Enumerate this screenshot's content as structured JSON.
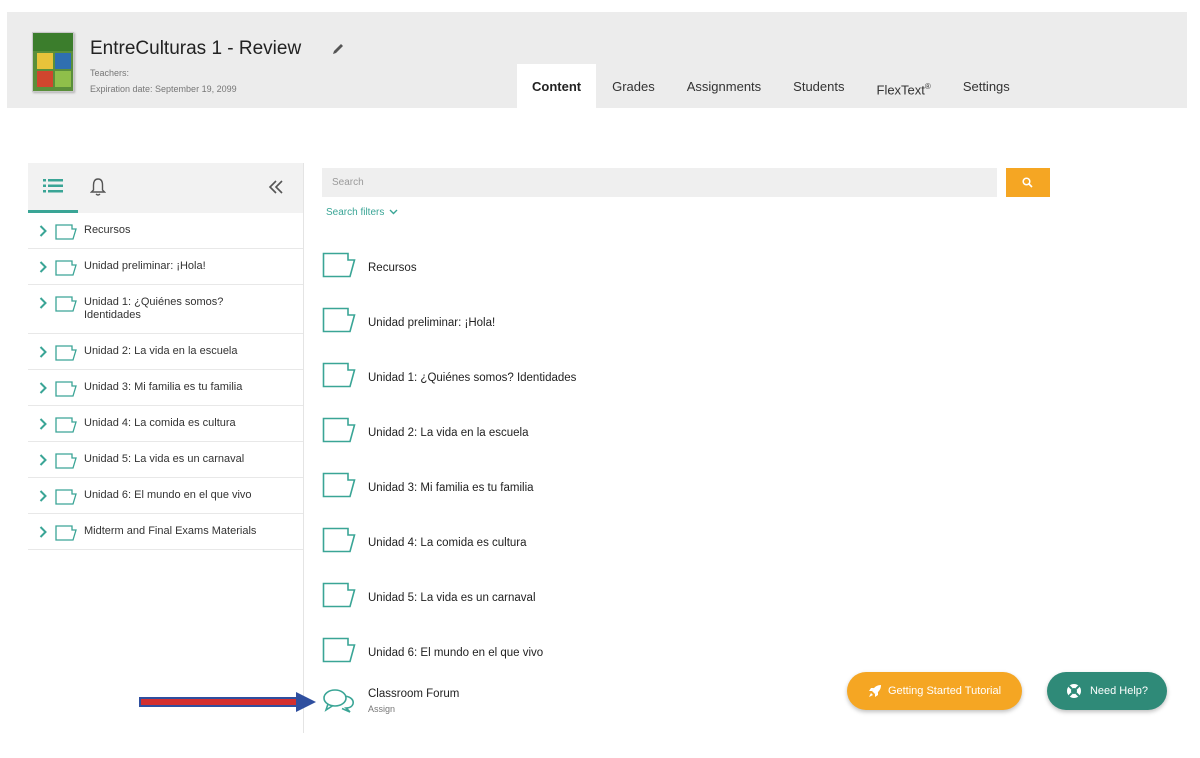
{
  "course": {
    "title": "EntreCulturas 1 - Review",
    "teachers": "Teachers:",
    "expiration": "Expiration date: September 19, 2099"
  },
  "tabs": [
    {
      "label": "Content",
      "active": true
    },
    {
      "label": "Grades",
      "active": false
    },
    {
      "label": "Assignments",
      "active": false
    },
    {
      "label": "Students",
      "active": false
    },
    {
      "label": "FlexText",
      "sup": "®",
      "active": false
    },
    {
      "label": "Settings",
      "active": false
    }
  ],
  "sidebar": {
    "items": [
      {
        "label": "Recursos"
      },
      {
        "label": "Unidad preliminar: ¡Hola!"
      },
      {
        "label": "Unidad 1: ¿Quiénes somos? Identidades"
      },
      {
        "label": "Unidad 2: La vida en la escuela"
      },
      {
        "label": "Unidad 3: Mi familia es tu familia"
      },
      {
        "label": "Unidad 4: La comida es cultura"
      },
      {
        "label": "Unidad 5: La vida es un carnaval"
      },
      {
        "label": "Unidad 6: El mundo en el que vivo"
      },
      {
        "label": "Midterm and Final Exams Materials"
      }
    ]
  },
  "search": {
    "placeholder": "Search",
    "filters_label": "Search filters"
  },
  "content": {
    "items": [
      {
        "label": "Recursos"
      },
      {
        "label": "Unidad preliminar: ¡Hola!"
      },
      {
        "label": "Unidad 1: ¿Quiénes somos? Identidades"
      },
      {
        "label": "Unidad 2: La vida en la escuela"
      },
      {
        "label": "Unidad 3: Mi familia es tu familia"
      },
      {
        "label": "Unidad 4: La comida es cultura"
      },
      {
        "label": "Unidad 5: La vida es un carnaval"
      },
      {
        "label": "Unidad 6: El mundo en el que vivo"
      }
    ],
    "forum": {
      "label": "Classroom Forum",
      "sub": "Assign"
    }
  },
  "buttons": {
    "tutorial": "Getting Started Tutorial",
    "help": "Need Help?"
  },
  "colors": {
    "accent": "#3aa596",
    "orange": "#f5a623",
    "help": "#2f8a78",
    "annotation_arrow": "#d32f2f"
  },
  "icons": {
    "edit": "pencil-icon",
    "list_view": "list-icon",
    "notifications": "bell-icon",
    "collapse": "double-chevron-left-icon",
    "expand": "chevron-right-icon",
    "folder": "folder-icon",
    "search": "magnifier-icon",
    "forum": "chat-bubbles-icon",
    "tutorial": "rocket-icon",
    "help": "lifebuoy-icon"
  }
}
